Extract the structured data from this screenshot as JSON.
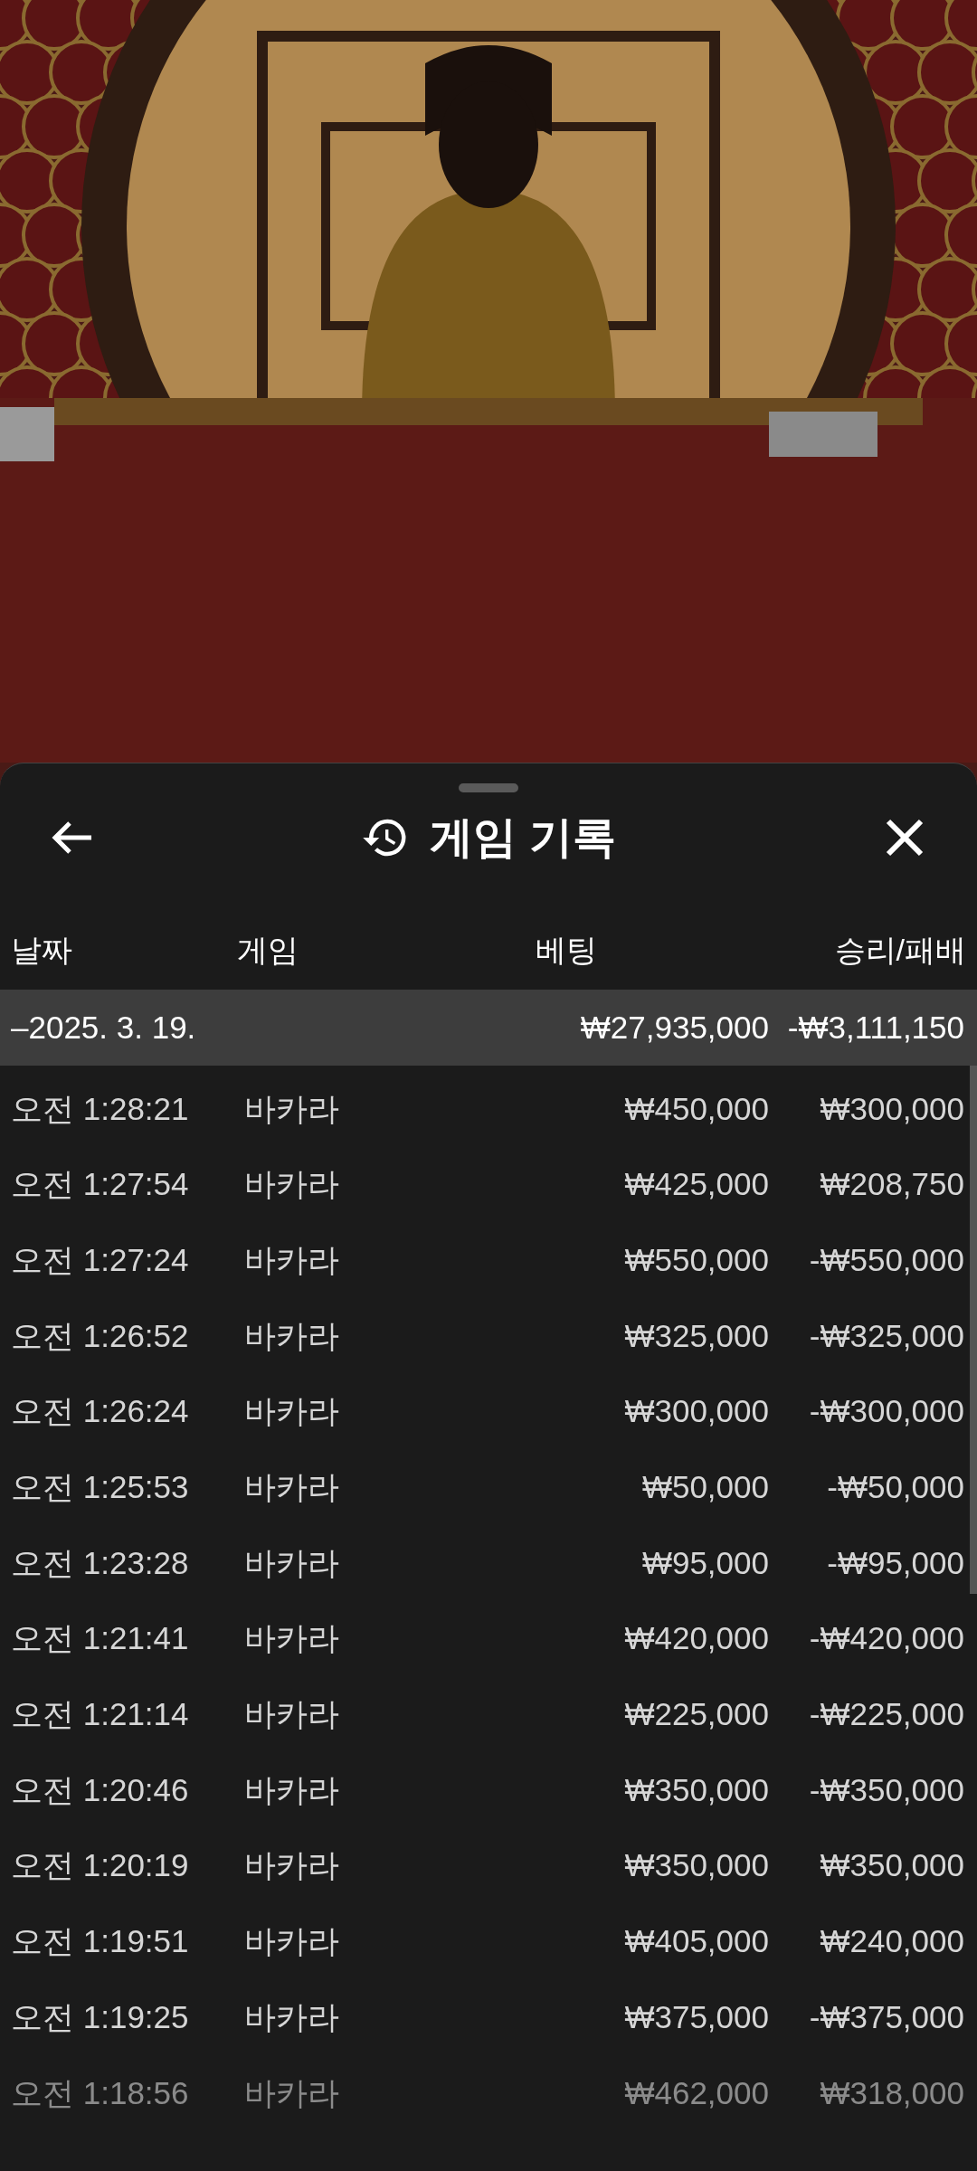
{
  "sheet": {
    "title": "게임 기록"
  },
  "columns": [
    "날짜",
    "게임",
    "베팅",
    "승리/패배"
  ],
  "summary": {
    "date": "–2025. 3. 19.",
    "bet": "₩27,935,000",
    "result": "-₩3,111,150"
  },
  "rows": [
    {
      "time": "오전 1:28:21",
      "game": "바카라",
      "bet": "₩450,000",
      "result": "₩300,000",
      "faded": false
    },
    {
      "time": "오전 1:27:54",
      "game": "바카라",
      "bet": "₩425,000",
      "result": "₩208,750",
      "faded": false
    },
    {
      "time": "오전 1:27:24",
      "game": "바카라",
      "bet": "₩550,000",
      "result": "-₩550,000",
      "faded": false
    },
    {
      "time": "오전 1:26:52",
      "game": "바카라",
      "bet": "₩325,000",
      "result": "-₩325,000",
      "faded": false
    },
    {
      "time": "오전 1:26:24",
      "game": "바카라",
      "bet": "₩300,000",
      "result": "-₩300,000",
      "faded": false
    },
    {
      "time": "오전 1:25:53",
      "game": "바카라",
      "bet": "₩50,000",
      "result": "-₩50,000",
      "faded": false
    },
    {
      "time": "오전 1:23:28",
      "game": "바카라",
      "bet": "₩95,000",
      "result": "-₩95,000",
      "faded": false
    },
    {
      "time": "오전 1:21:41",
      "game": "바카라",
      "bet": "₩420,000",
      "result": "-₩420,000",
      "faded": false
    },
    {
      "time": "오전 1:21:14",
      "game": "바카라",
      "bet": "₩225,000",
      "result": "-₩225,000",
      "faded": false
    },
    {
      "time": "오전 1:20:46",
      "game": "바카라",
      "bet": "₩350,000",
      "result": "-₩350,000",
      "faded": false
    },
    {
      "time": "오전 1:20:19",
      "game": "바카라",
      "bet": "₩350,000",
      "result": "₩350,000",
      "faded": false
    },
    {
      "time": "오전 1:19:51",
      "game": "바카라",
      "bet": "₩405,000",
      "result": "₩240,000",
      "faded": false
    },
    {
      "time": "오전 1:19:25",
      "game": "바카라",
      "bet": "₩375,000",
      "result": "-₩375,000",
      "faded": false
    },
    {
      "time": "오전 1:18:56",
      "game": "바카라",
      "bet": "₩462,000",
      "result": "₩318,000",
      "faded": true
    }
  ]
}
